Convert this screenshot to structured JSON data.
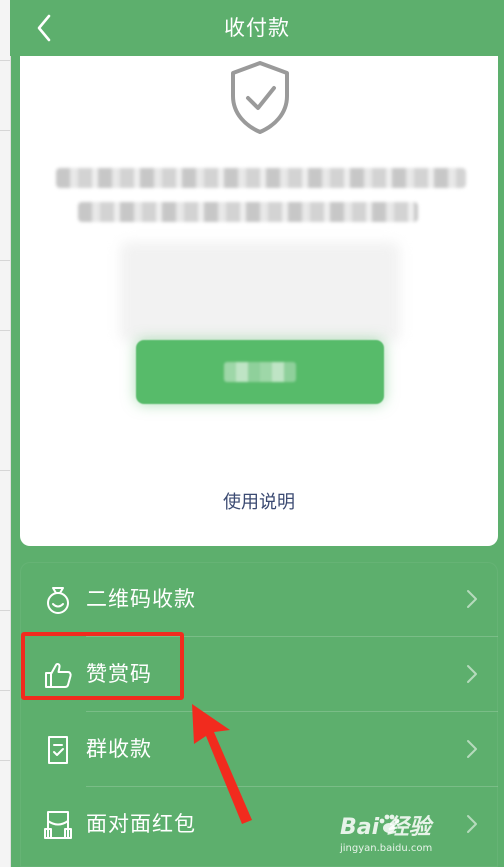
{
  "header": {
    "title": "收付款",
    "back_icon": "chevron-left-icon"
  },
  "card": {
    "shield_icon": "shield-check-icon",
    "usage_link": "使用说明"
  },
  "menu": {
    "items": [
      {
        "label": "二维码收款",
        "icon": "money-bag-icon"
      },
      {
        "label": "赞赏码",
        "icon": "thumbs-up-icon"
      },
      {
        "label": "群收款",
        "icon": "document-icon"
      },
      {
        "label": "面对面红包",
        "icon": "red-envelope-icon"
      }
    ],
    "chevron_icon": "chevron-right-icon"
  },
  "annotation": {
    "highlight_color": "#f12b1e",
    "arrow_icon": "red-arrow-icon"
  },
  "watermark": {
    "brand": "Bai  经验",
    "sub": "jingyan.baidu.com"
  },
  "colors": {
    "brand_green": "#5daf6d",
    "button_green": "#57bb6a",
    "link_blue": "#3b4a72"
  }
}
